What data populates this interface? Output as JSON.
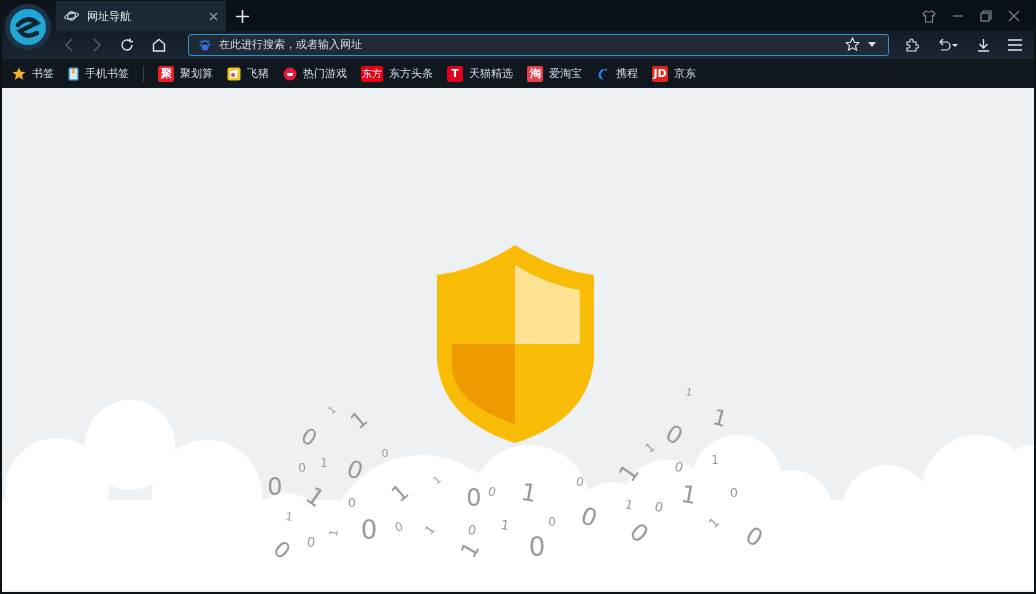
{
  "tabs": [
    {
      "title": "网址导航",
      "selected": true
    }
  ],
  "address_bar": {
    "placeholder": "在此进行搜索，或者输入网址"
  },
  "bookmarks": [
    {
      "label": "书签",
      "kind": "star"
    },
    {
      "label": "手机书签",
      "kind": "phone"
    },
    {
      "label": "聚划算",
      "kind": "badge",
      "badge": "聚",
      "color": "#e8212b"
    },
    {
      "label": "飞猪",
      "kind": "pig"
    },
    {
      "label": "热门游戏",
      "kind": "game"
    },
    {
      "label": "东方头条",
      "kind": "badge",
      "badge": "东方",
      "color": "#e50012"
    },
    {
      "label": "天猫精选",
      "kind": "badge",
      "badge": "T",
      "color": "#e0001b"
    },
    {
      "label": "爱淘宝",
      "kind": "badge",
      "badge": "淘",
      "color": "#e8404a"
    },
    {
      "label": "携程",
      "kind": "dolphin"
    },
    {
      "label": "京东",
      "kind": "badge",
      "badge": "JD",
      "color": "#e1251b"
    }
  ],
  "digits": [
    "1",
    "1",
    "0",
    "0",
    "0",
    "1",
    "0",
    "0",
    "1",
    "0",
    "1",
    "1",
    "1",
    "0",
    "0",
    "1",
    "0",
    "0",
    "1",
    "0",
    "0",
    "1",
    "0",
    "1",
    "0",
    "1",
    "0",
    "0",
    "0",
    "1",
    "0",
    "1",
    "0",
    "1",
    "0",
    "1",
    "1",
    "0",
    "1",
    "1",
    "0",
    "1",
    "0"
  ]
}
